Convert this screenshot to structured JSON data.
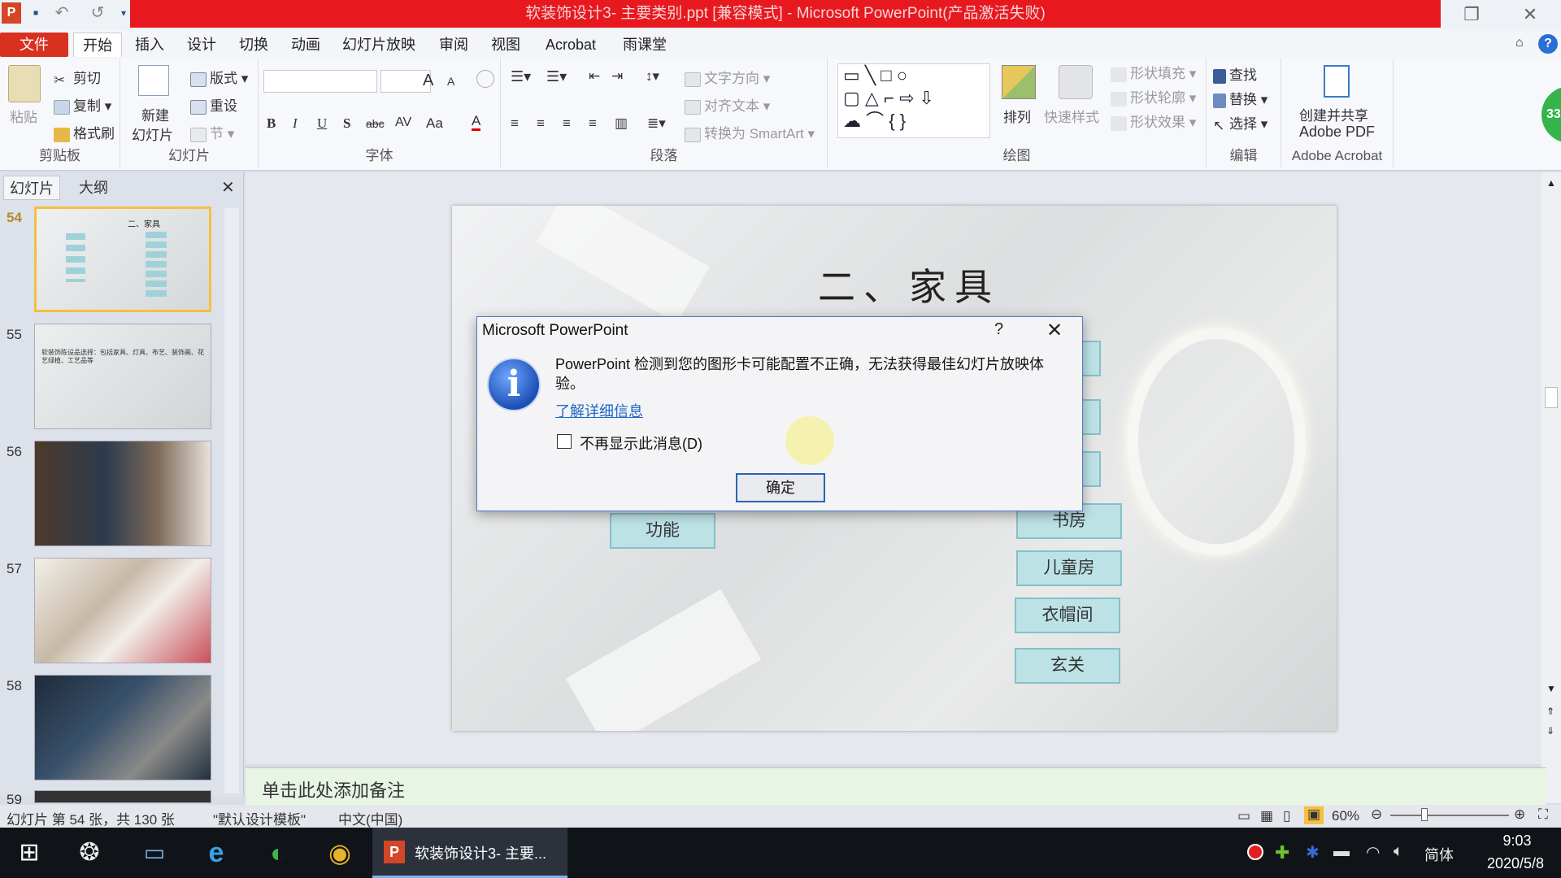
{
  "window": {
    "title": "软装饰设计3- 主要类别.ppt [兼容模式] - Microsoft PowerPoint(产品激活失败)"
  },
  "menu": {
    "tabs": [
      "文件",
      "开始",
      "插入",
      "设计",
      "切换",
      "动画",
      "幻灯片放映",
      "审阅",
      "视图",
      "Acrobat",
      "雨课堂"
    ],
    "active": "开始"
  },
  "ribbon": {
    "clipboard": {
      "paste": "粘贴",
      "cut": "剪切",
      "copy": "复制",
      "format_painter": "格式刷",
      "label": "剪贴板"
    },
    "slides": {
      "new_slide_line1": "新建",
      "new_slide_line2": "幻灯片",
      "layout": "版式",
      "reset": "重设",
      "section": "节",
      "label": "幻灯片"
    },
    "font": {
      "label": "字体",
      "bold": "B",
      "italic": "I",
      "underline": "U",
      "shadow": "S",
      "strike": "abc",
      "spacing": "AV",
      "case": "Aa",
      "grow": "A",
      "shrink": "A"
    },
    "paragraph": {
      "text_direction": "文字方向",
      "align_text": "对齐文本",
      "convert_smartart": "转换为 SmartArt",
      "label": "段落"
    },
    "drawing": {
      "arrange": "排列",
      "quick_styles": "快速样式",
      "shape_fill": "形状填充",
      "shape_outline": "形状轮廓",
      "shape_effects": "形状效果",
      "label": "绘图"
    },
    "editing": {
      "find": "查找",
      "replace": "替换",
      "select": "选择",
      "label": "编辑"
    },
    "acrobat": {
      "create_line1": "创建并共享",
      "create_line2": "Adobe PDF",
      "label": "Adobe Acrobat"
    },
    "badge": "33"
  },
  "panel": {
    "tab_slides": "幻灯片",
    "tab_outline": "大纲",
    "slides": [
      {
        "num": "54"
      },
      {
        "num": "55"
      },
      {
        "num": "56"
      },
      {
        "num": "57"
      },
      {
        "num": "58"
      },
      {
        "num": "59"
      }
    ],
    "thumb54_title": "二、家具",
    "thumb55_text": "软装饰陈设品选择：包括家具、灯具、布艺、装饰画、花艺绿植、工艺品等"
  },
  "slide": {
    "title": "二、家具",
    "boxes": [
      "书房",
      "儿童房",
      "衣帽间",
      "玄关",
      "功能"
    ]
  },
  "dialog": {
    "title": "Microsoft PowerPoint",
    "help": "?",
    "message": "PowerPoint 检测到您的图形卡可能配置不正确，无法获得最佳幻灯片放映体验。",
    "link": "了解详细信息",
    "checkbox_label": "不再显示此消息(D)",
    "ok": "确定"
  },
  "notes": {
    "placeholder": "单击此处添加备注"
  },
  "status": {
    "slide_info": "幻灯片 第 54 张，共 130 张",
    "theme": "\"默认设计模板\"",
    "language": "中文(中国)",
    "zoom": "60%"
  },
  "taskbar": {
    "task_label": "软装饰设计3- 主要...",
    "ime": "简体",
    "time": "9:03",
    "date": "2020/5/8"
  },
  "colors": {
    "title_red": "#e8181f",
    "file_tab": "#d9311f",
    "slide_box": "#bde2e6",
    "accent_blue": "#1f66c8"
  }
}
